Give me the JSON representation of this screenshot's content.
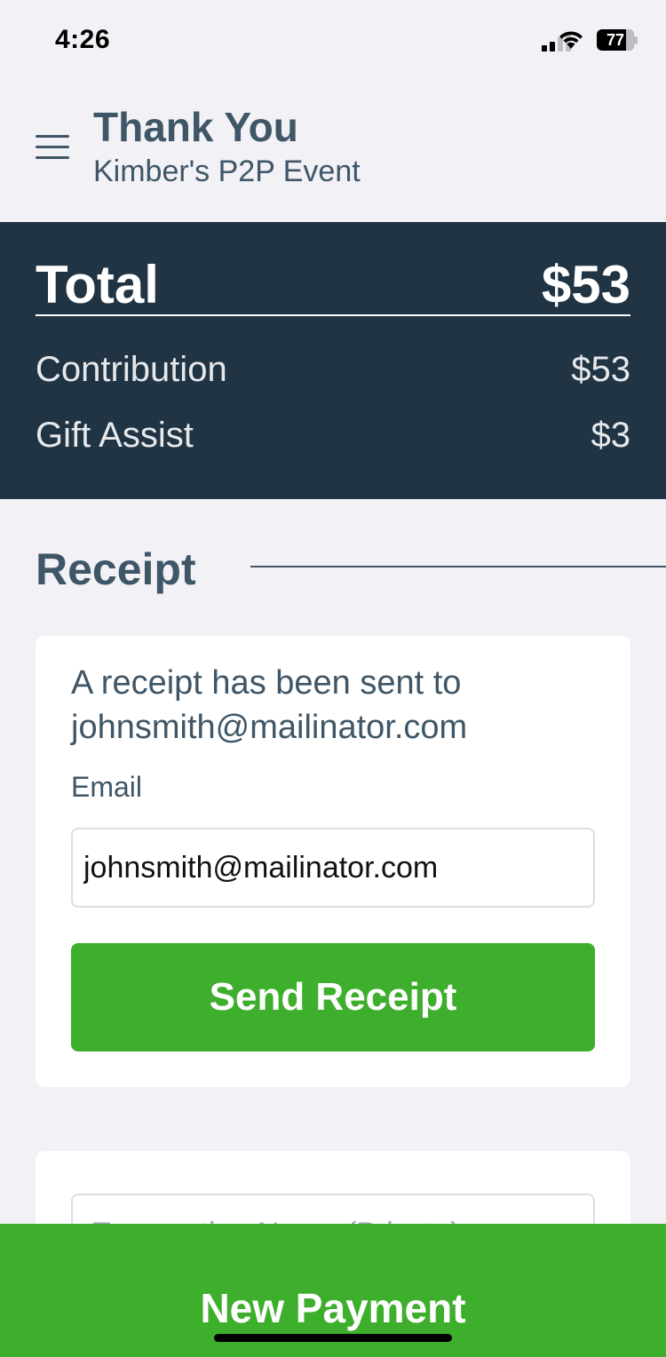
{
  "status_bar": {
    "time": "4:26",
    "battery": "77",
    "icons": [
      "cellular-signal-icon",
      "wifi-icon",
      "battery-icon"
    ]
  },
  "header": {
    "title": "Thank You",
    "subtitle": "Kimber's P2P Event",
    "menu_icon": "hamburger-menu-icon"
  },
  "totals": {
    "total_label": "Total",
    "total_value": "$53",
    "lines": [
      {
        "label": "Contribution",
        "value": "$53"
      },
      {
        "label": "Gift Assist",
        "value": "$3"
      }
    ]
  },
  "receipt": {
    "heading": "Receipt",
    "message": "A receipt has been sent to johnsmith@mailinator.com",
    "email_label": "Email",
    "email_value": "johnsmith@mailinator.com",
    "send_label": "Send Receipt"
  },
  "second_card": {
    "placeholder": "Transaction Name (Private)"
  },
  "footer": {
    "new_payment_label": "New Payment"
  },
  "colors": {
    "primary_text": "#3f5667",
    "dark_panel": "#213444",
    "accent_green": "#3eaf2c",
    "background": "#f1f1f6"
  }
}
